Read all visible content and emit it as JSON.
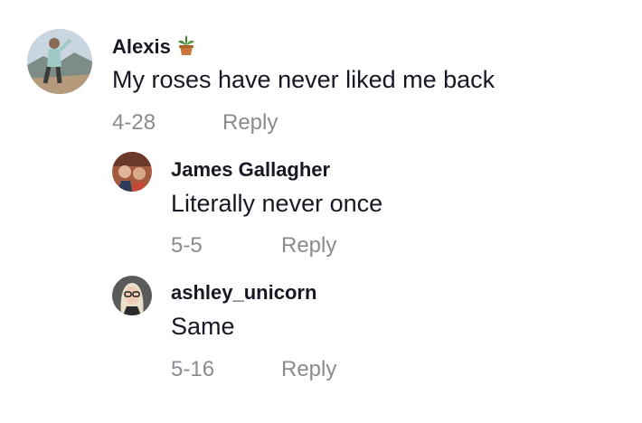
{
  "comments": [
    {
      "username": "Alexis",
      "text": "My roses have never liked me back",
      "date": "4-28",
      "reply_label": "Reply",
      "badge_icon": "potted-plant-icon"
    },
    {
      "username": "James Gallagher",
      "text": "Literally never once",
      "date": "5-5",
      "reply_label": "Reply"
    },
    {
      "username": "ashley_unicorn",
      "text": "Same",
      "date": "5-16",
      "reply_label": "Reply"
    }
  ],
  "colors": {
    "text_primary": "#161823",
    "text_secondary": "#8a8b91",
    "background": "#ffffff"
  }
}
